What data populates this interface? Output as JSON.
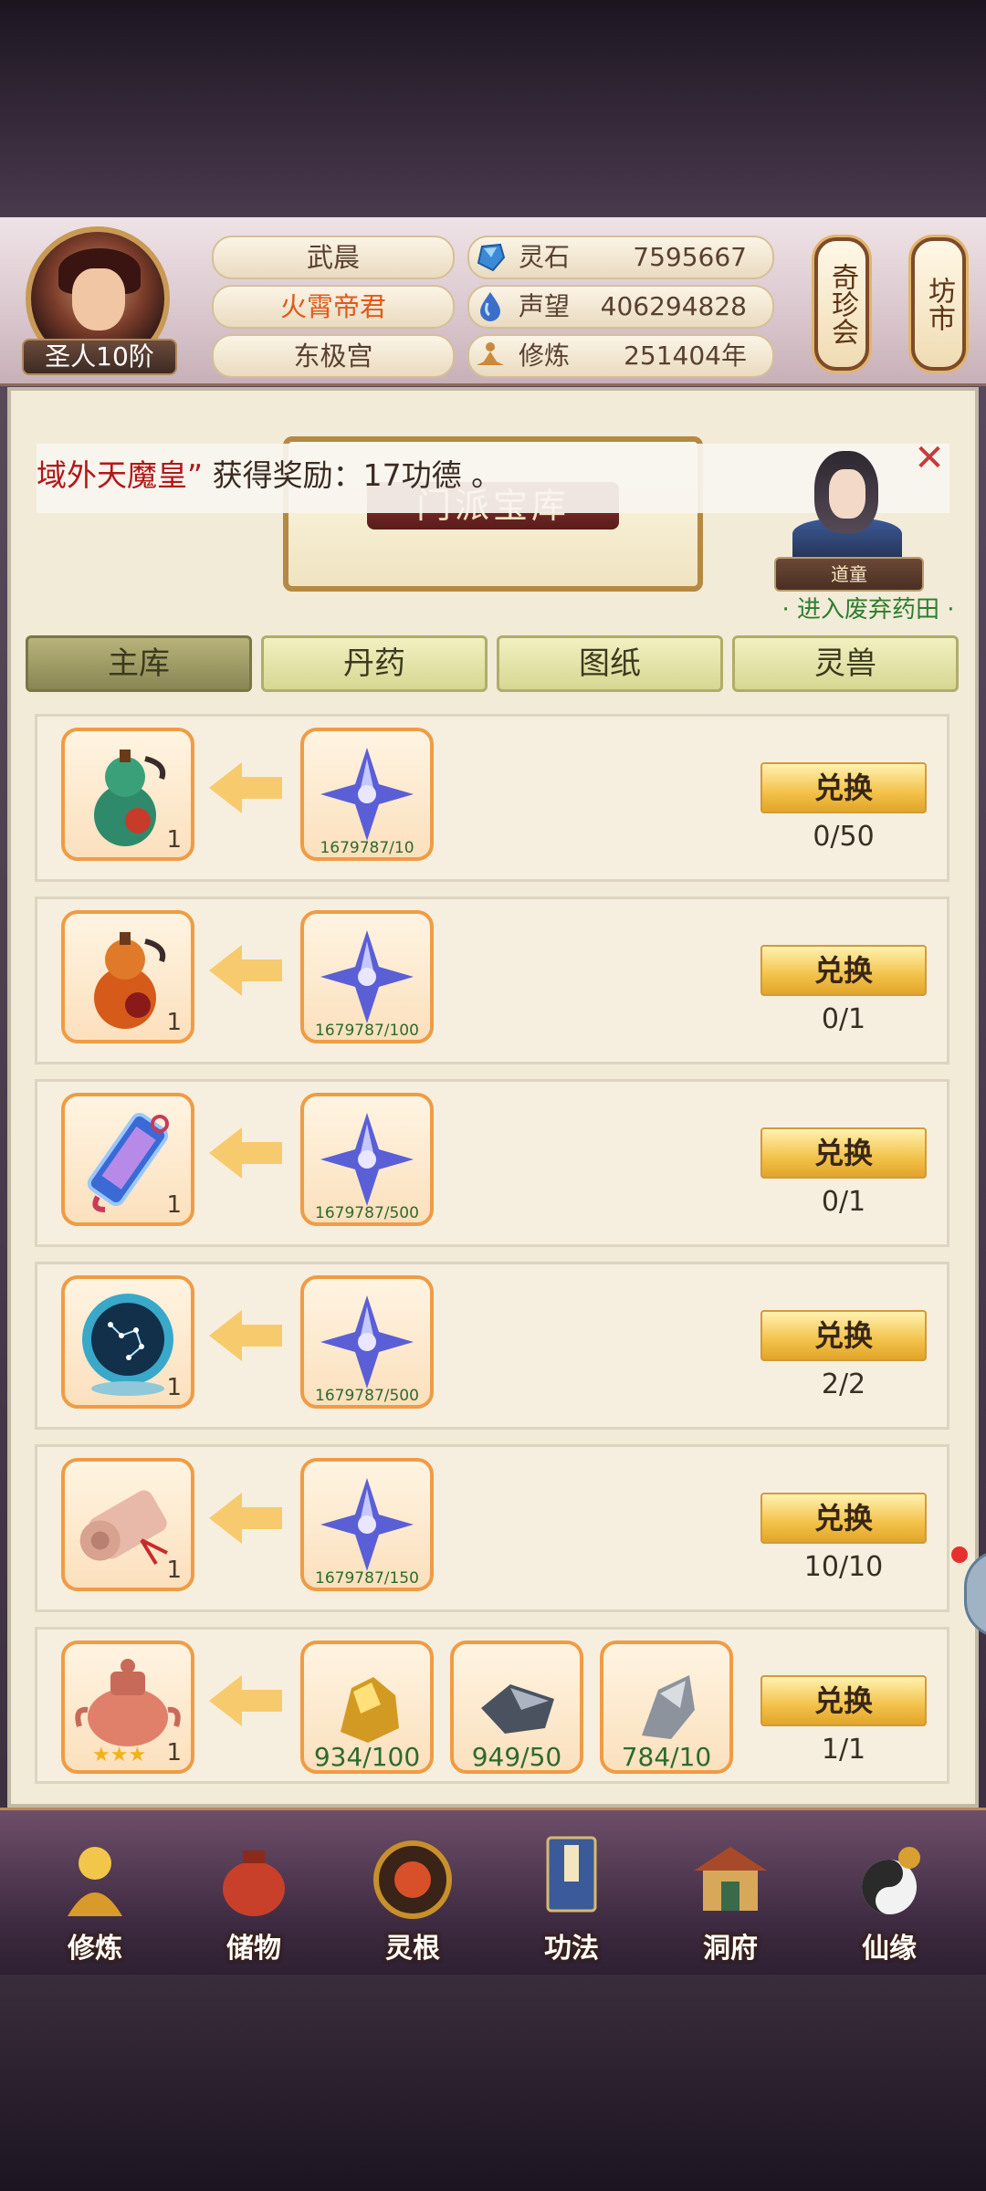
{
  "player": {
    "name": "武晨",
    "title": "火霄帝君",
    "sect": "东极宫",
    "rank": "圣人10阶"
  },
  "resources": [
    {
      "label": "灵石",
      "value": "7595667",
      "icon": "spirit-stone-icon",
      "color": "#3a8ad6"
    },
    {
      "label": "声望",
      "value": "406294828",
      "icon": "prestige-drop-icon",
      "color": "#3b6ec8"
    },
    {
      "label": "修炼",
      "value": "251404年",
      "icon": "meditation-icon",
      "color": "#c98a3a"
    }
  ],
  "side_buttons": {
    "treasure": "奇珍会",
    "market": "坊市"
  },
  "banner": {
    "title": "门派宝库"
  },
  "notice": {
    "highlight": "域外天魔皇”",
    "text": "获得奖励：17功德 。"
  },
  "npc": {
    "tag": "道童",
    "enter": "· 进入废弃药田 ·"
  },
  "tabs": [
    "主库",
    "丹药",
    "图纸",
    "灵兽"
  ],
  "exchange_label": "兑换",
  "rows": [
    {
      "reward": "green-gourd-icon",
      "reward_qty": "1",
      "costs": [
        {
          "icon": "star-crystal-icon",
          "count": "1679787/10"
        }
      ],
      "limit": "0/50"
    },
    {
      "reward": "orange-gourd-icon",
      "reward_qty": "1",
      "costs": [
        {
          "icon": "star-crystal-icon",
          "count": "1679787/100"
        }
      ],
      "limit": "0/1"
    },
    {
      "reward": "jade-token-icon",
      "reward_qty": "1",
      "costs": [
        {
          "icon": "star-crystal-icon",
          "count": "1679787/500"
        }
      ],
      "limit": "0/1"
    },
    {
      "reward": "constellation-orb-icon",
      "reward_qty": "1",
      "costs": [
        {
          "icon": "star-crystal-icon",
          "count": "1679787/500"
        }
      ],
      "limit": "2/2"
    },
    {
      "reward": "scroll-icon",
      "reward_qty": "1",
      "costs": [
        {
          "icon": "star-crystal-icon",
          "count": "1679787/150"
        }
      ],
      "limit": "10/10"
    },
    {
      "reward": "incense-cauldron-icon",
      "reward_qty": "1",
      "costs": [
        {
          "icon": "gold-ore-icon",
          "count": "934/100"
        },
        {
          "icon": "dark-iron-icon",
          "count": "949/50"
        },
        {
          "icon": "silver-ore-icon",
          "count": "784/10"
        }
      ],
      "limit": "1/1"
    }
  ],
  "bottom_nav": [
    {
      "label": "修炼",
      "icon": "cultivate-monk-icon"
    },
    {
      "label": "储物",
      "icon": "storage-bag-icon"
    },
    {
      "label": "灵根",
      "icon": "spirit-root-icon"
    },
    {
      "label": "功法",
      "icon": "technique-book-icon"
    },
    {
      "label": "洞府",
      "icon": "cave-house-icon"
    },
    {
      "label": "仙缘",
      "icon": "immortal-fate-icon"
    }
  ]
}
